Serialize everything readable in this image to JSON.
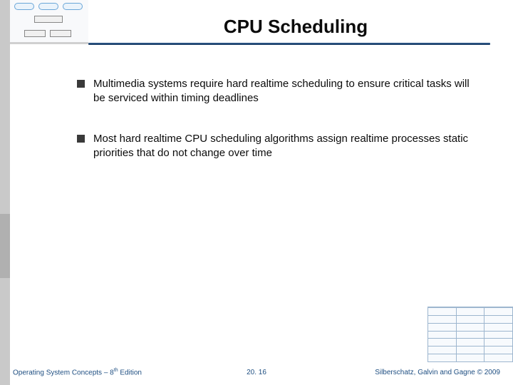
{
  "title": "CPU Scheduling",
  "bullets": {
    "b1": "Multimedia systems require hard realtime scheduling to ensure critical tasks will be serviced within timing deadlines",
    "b2": "Most hard realtime CPU scheduling algorithms assign realtime processes static priorities that do not change over time"
  },
  "footer": {
    "left_prefix": "Operating System Concepts – 8",
    "left_sup": "th",
    "left_suffix": " Edition",
    "center": "20. 16",
    "right": "Silberschatz, Galvin and Gagne © 2009"
  }
}
